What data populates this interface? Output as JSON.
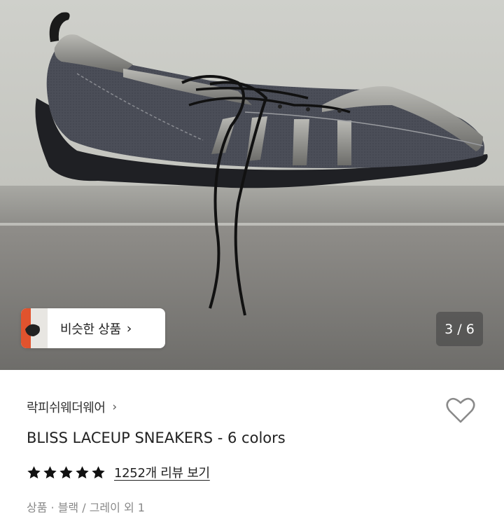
{
  "gallery": {
    "similar_label": "비슷한 상품",
    "chevron": "›",
    "page_counter": "3 / 6"
  },
  "product": {
    "brand": "락피쉬웨더웨어",
    "brand_chevron": "›",
    "title": "BLISS LACEUP SNEAKERS - 6 colors",
    "rating": 5,
    "review_link": "1252개 리뷰 보기",
    "option_line": "상품 · 블랙 / 그레이 외 1"
  },
  "colors": {
    "star": "#111111",
    "heart_outline": "#888888",
    "counter_bg": "#4a4a4a"
  }
}
